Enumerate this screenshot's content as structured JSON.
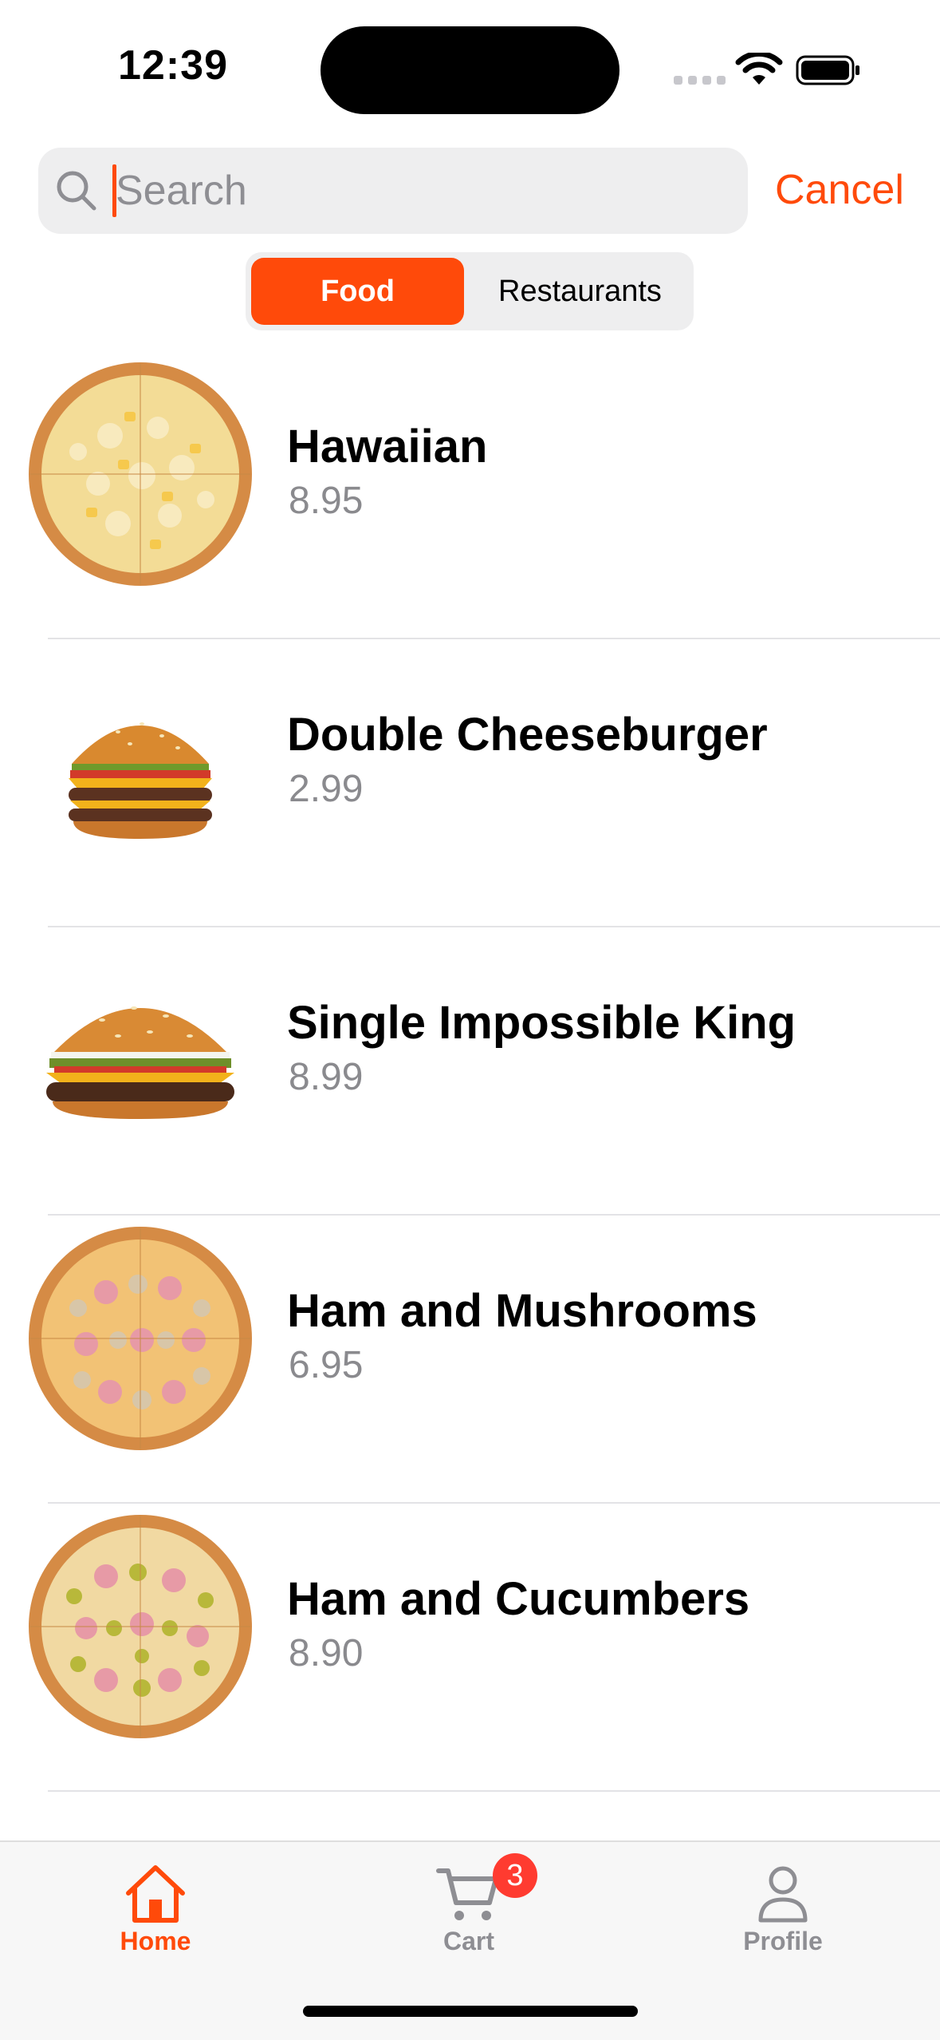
{
  "status_bar": {
    "time": "12:39"
  },
  "search": {
    "placeholder": "Search",
    "value": "",
    "cancel_label": "Cancel"
  },
  "segments": {
    "food": "Food",
    "restaurants": "Restaurants",
    "selected": "Food"
  },
  "items": [
    {
      "name": "Hawaiian",
      "price": "8.95",
      "image": "pizza-hawaiian"
    },
    {
      "name": "Double Cheeseburger",
      "price": "2.99",
      "image": "burger-double-cheese"
    },
    {
      "name": "Single Impossible King",
      "price": "8.99",
      "image": "burger-impossible-king"
    },
    {
      "name": "Ham and Mushrooms",
      "price": "6.95",
      "image": "pizza-ham-mushrooms"
    },
    {
      "name": "Ham and Cucumbers",
      "price": "8.90",
      "image": "pizza-ham-cucumbers"
    }
  ],
  "tabbar": {
    "home_label": "Home",
    "cart_label": "Cart",
    "cart_badge": "3",
    "profile_label": "Profile",
    "active": "Home"
  },
  "colors": {
    "accent": "#ff4a0a",
    "secondary_text": "#8a8a8e",
    "badge": "#ff3b30",
    "inactive_tab": "#8e8e93"
  }
}
